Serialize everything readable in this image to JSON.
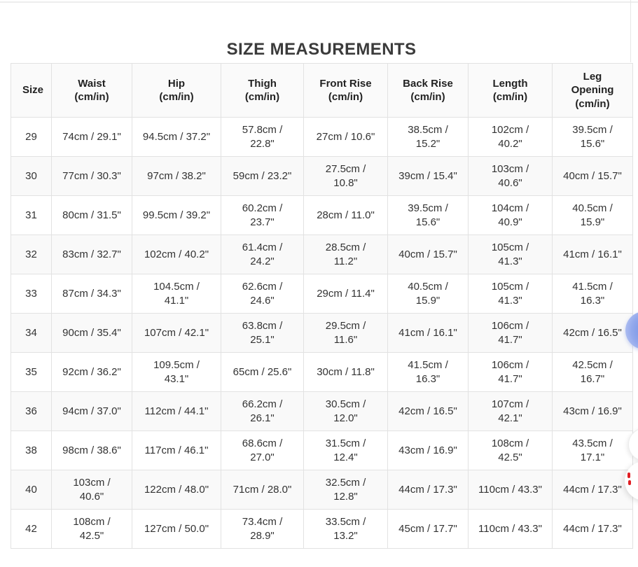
{
  "page": {
    "title": "SIZE MEASUREMENTS"
  },
  "table": {
    "column_keys": [
      "size",
      "waist",
      "hip",
      "thigh",
      "front-rise",
      "back-rise",
      "length",
      "leg-opening"
    ],
    "headers": [
      {
        "name": "Size",
        "unit": ""
      },
      {
        "name": "Waist",
        "unit": "(cm/in)"
      },
      {
        "name": "Hip",
        "unit": "(cm/in)"
      },
      {
        "name": "Thigh",
        "unit": "(cm/in)"
      },
      {
        "name": "Front Rise",
        "unit": "(cm/in)"
      },
      {
        "name": "Back Rise",
        "unit": "(cm/in)"
      },
      {
        "name": "Length",
        "unit": "(cm/in)"
      },
      {
        "name": "Leg Opening",
        "unit": "(cm/in)"
      }
    ],
    "rows": [
      {
        "cells": [
          "29",
          "74cm / 29.1\"",
          "94.5cm / 37.2\"",
          "57.8cm / 22.8\"",
          "27cm / 10.6\"",
          "38.5cm / 15.2\"",
          "102cm / 40.2\"",
          "39.5cm / 15.6\""
        ]
      },
      {
        "cells": [
          "30",
          "77cm / 30.3\"",
          "97cm / 38.2\"",
          "59cm / 23.2\"",
          "27.5cm / 10.8\"",
          "39cm / 15.4\"",
          "103cm / 40.6\"",
          "40cm / 15.7\""
        ]
      },
      {
        "cells": [
          "31",
          "80cm / 31.5\"",
          "99.5cm / 39.2\"",
          "60.2cm / 23.7\"",
          "28cm / 11.0\"",
          "39.5cm / 15.6\"",
          "104cm / 40.9\"",
          "40.5cm / 15.9\""
        ]
      },
      {
        "cells": [
          "32",
          "83cm / 32.7\"",
          "102cm / 40.2\"",
          "61.4cm / 24.2\"",
          "28.5cm / 11.2\"",
          "40cm / 15.7\"",
          "105cm / 41.3\"",
          "41cm / 16.1\""
        ]
      },
      {
        "cells": [
          "33",
          "87cm / 34.3\"",
          "104.5cm / 41.1\"",
          "62.6cm / 24.6\"",
          "29cm / 11.4\"",
          "40.5cm / 15.9\"",
          "105cm / 41.3\"",
          "41.5cm / 16.3\""
        ]
      },
      {
        "cells": [
          "34",
          "90cm / 35.4\"",
          "107cm / 42.1\"",
          "63.8cm / 25.1\"",
          "29.5cm / 11.6\"",
          "41cm / 16.1\"",
          "106cm / 41.7\"",
          "42cm / 16.5\""
        ]
      },
      {
        "cells": [
          "35",
          "92cm / 36.2\"",
          "109.5cm / 43.1\"",
          "65cm / 25.6\"",
          "30cm / 11.8\"",
          "41.5cm / 16.3\"",
          "106cm / 41.7\"",
          "42.5cm / 16.7\""
        ]
      },
      {
        "cells": [
          "36",
          "94cm / 37.0\"",
          "112cm / 44.1\"",
          "66.2cm / 26.1\"",
          "30.5cm / 12.0\"",
          "42cm / 16.5\"",
          "107cm / 42.1\"",
          "43cm / 16.9\""
        ]
      },
      {
        "cells": [
          "38",
          "98cm / 38.6\"",
          "117cm / 46.1\"",
          "68.6cm / 27.0\"",
          "31.5cm / 12.4\"",
          "43cm / 16.9\"",
          "108cm / 42.5\"",
          "43.5cm / 17.1\""
        ]
      },
      {
        "cells": [
          "40",
          "103cm / 40.6\"",
          "122cm / 48.0\"",
          "71cm / 28.0\"",
          "32.5cm / 12.8\"",
          "44cm / 17.3\"",
          "110cm / 43.3\"",
          "44cm / 17.3\""
        ]
      },
      {
        "cells": [
          "42",
          "108cm / 42.5\"",
          "127cm / 50.0\"",
          "73.4cm / 28.9\"",
          "33.5cm / 13.2\"",
          "45cm / 17.7\"",
          "110cm / 43.3\"",
          "44cm / 17.3\""
        ]
      }
    ]
  },
  "floating_widgets": {
    "chat_button": {
      "icon": "chat-bubble-icon",
      "color": "#8ba4ea"
    },
    "middle_button": {
      "icon": "circle-icon",
      "color": "#ffffff"
    },
    "brand_button": {
      "icon": "red-dots-icon",
      "color": "#e01e23"
    }
  },
  "colors": {
    "title_text": "#3b3b3b",
    "cell_text": "#333333",
    "table_border": "#e2e2e2",
    "zebra_row": "#f9f9f9",
    "header_background": "#fafafa",
    "accent_blue": "#8ba4ea",
    "accent_red": "#e01e23"
  }
}
